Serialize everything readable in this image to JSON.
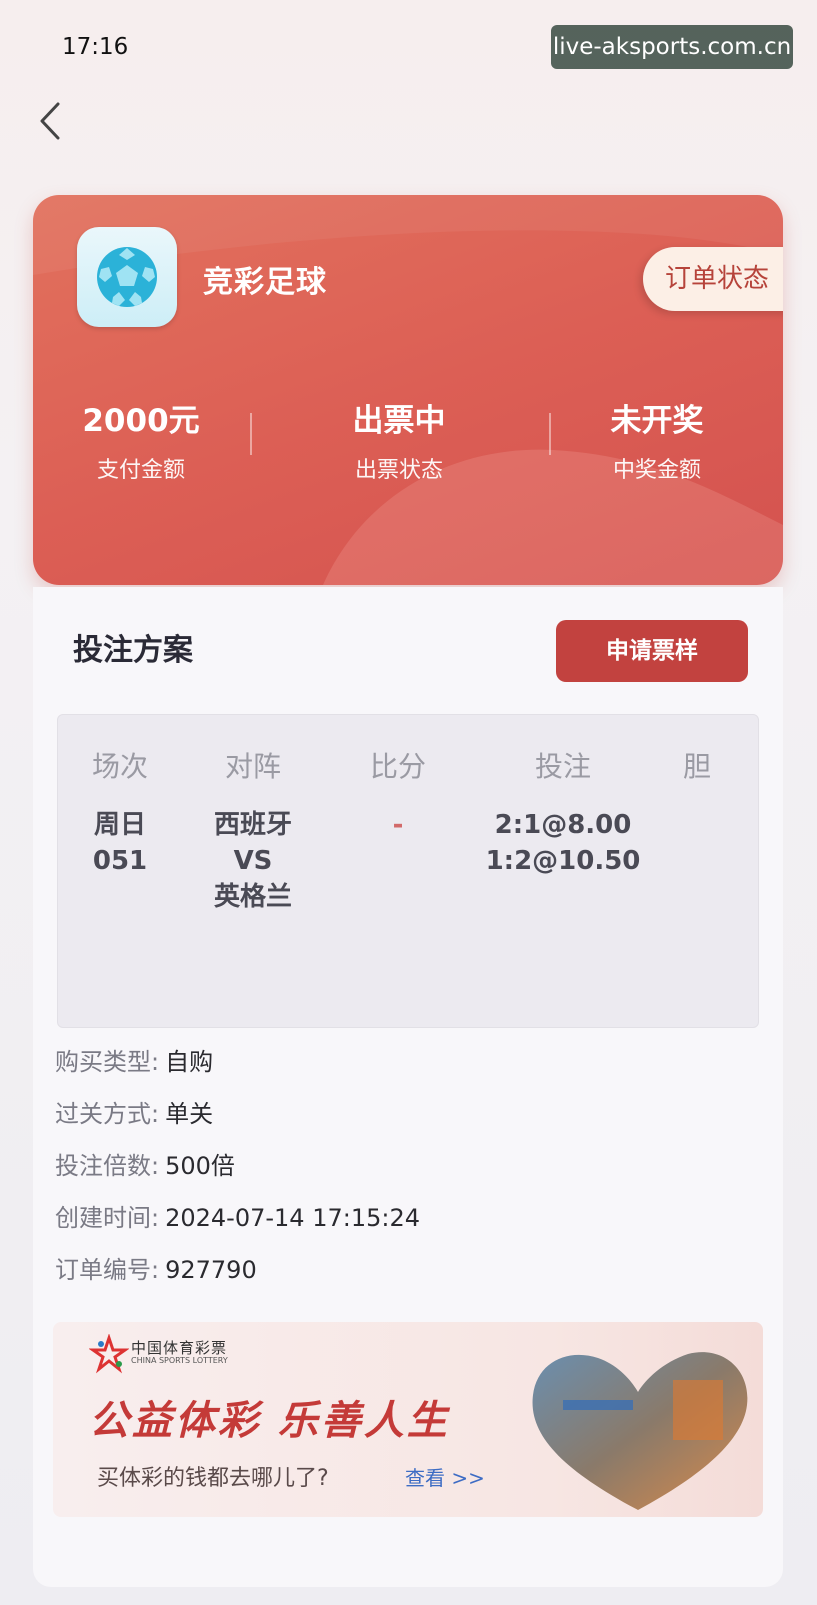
{
  "status_bar": {
    "time": "17:16"
  },
  "watermark": "live-aksports.com.cn",
  "header": {
    "game_name": "竞彩足球",
    "order_status_button": "订单状态",
    "stats": [
      {
        "value": "2000元",
        "label": "支付金额"
      },
      {
        "value": "出票中",
        "label": "出票状态"
      },
      {
        "value": "未开奖",
        "label": "中奖金额"
      }
    ]
  },
  "plan": {
    "title": "投注方案",
    "apply_button": "申请票样",
    "table": {
      "headers": [
        "场次",
        "对阵",
        "比分",
        "投注",
        "胆"
      ],
      "row": {
        "match_day": "周日",
        "match_no": "051",
        "home": "西班牙",
        "vs": "VS",
        "away": "英格兰",
        "score": "-",
        "bets": [
          "2:1@8.00",
          "1:2@10.50"
        ],
        "banker": ""
      }
    }
  },
  "details": [
    {
      "label": "购买类型:",
      "value": "自购"
    },
    {
      "label": "过关方式:",
      "value": "单关"
    },
    {
      "label": "投注倍数:",
      "value": "500倍"
    },
    {
      "label": "创建时间:",
      "value": "2024-07-14 17:15:24"
    },
    {
      "label": "订单编号:",
      "value": "927790"
    }
  ],
  "banner": {
    "brand_cn": "中国体育彩票",
    "brand_en": "CHINA SPORTS LOTTERY",
    "slogan": "公益体彩 乐善人生",
    "question": "买体彩的钱都去哪儿了?",
    "link": "查看 >>"
  },
  "colors": {
    "card_red": "#dc5f55",
    "button_red": "#c2423f",
    "accent_blue": "#3d6cc4"
  },
  "icons": [
    "back-arrow-icon",
    "football-icon",
    "lottery-logo-icon"
  ]
}
